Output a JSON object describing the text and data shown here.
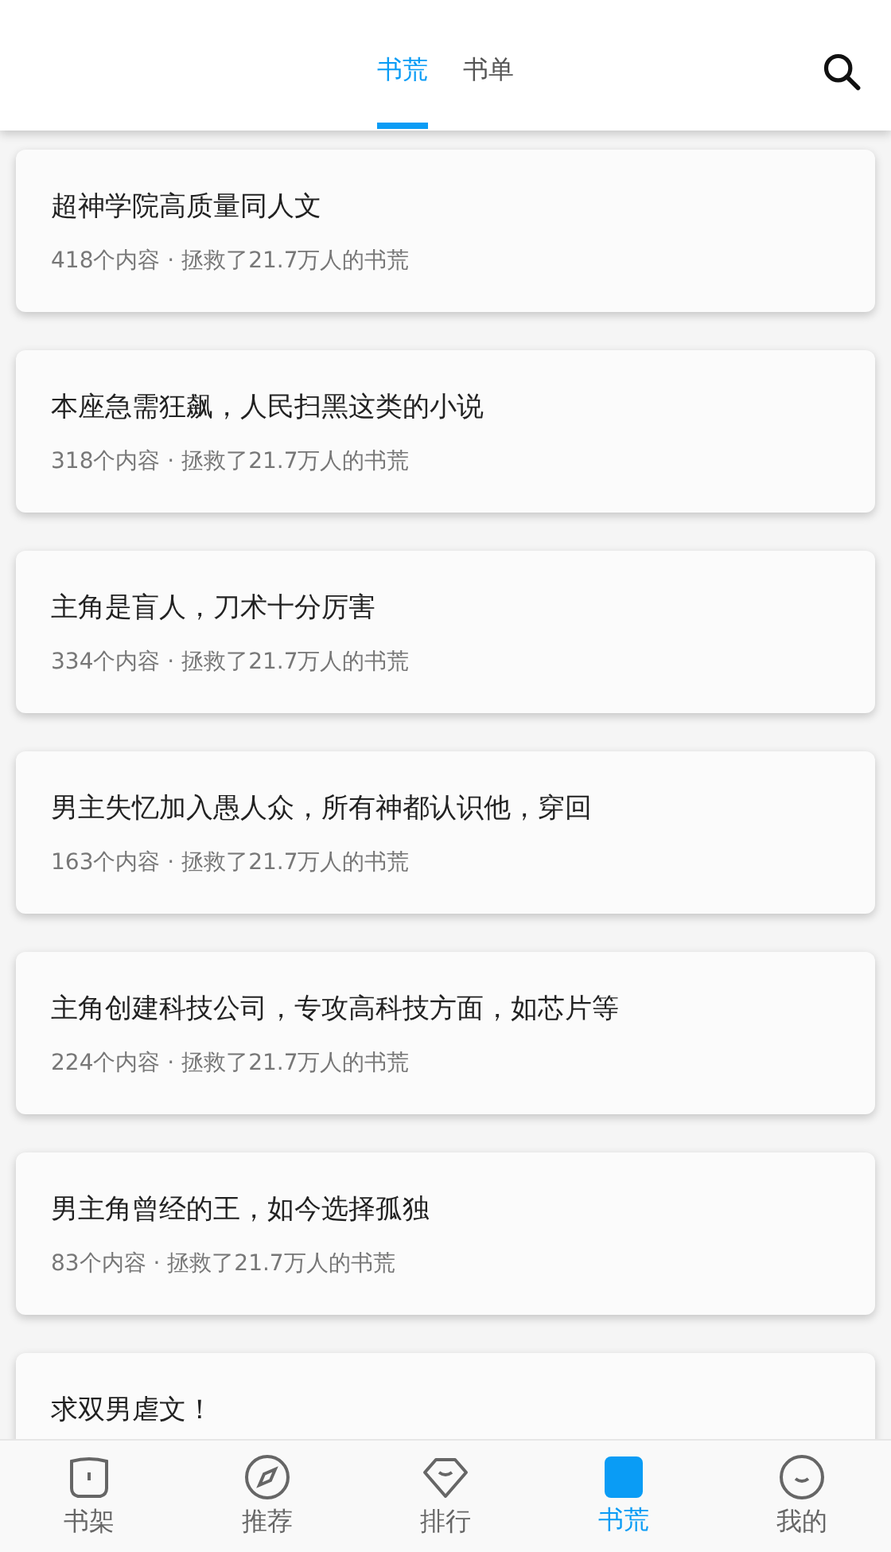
{
  "tabs": [
    {
      "label": "书荒",
      "selected": true
    },
    {
      "label": "书单",
      "selected": false
    }
  ],
  "lists": [
    {
      "title": "超神学院高质量同人文",
      "meta": "418个内容 · 拯救了21.7万人的书荒"
    },
    {
      "title": "本座急需狂飙，人民扫黑这类的小说",
      "meta": "318个内容 · 拯救了21.7万人的书荒"
    },
    {
      "title": "主角是盲人，刀术十分厉害",
      "meta": "334个内容 · 拯救了21.7万人的书荒"
    },
    {
      "title": "男主失忆加入愚人众，所有神都认识他，穿回",
      "meta": "163个内容 · 拯救了21.7万人的书荒"
    },
    {
      "title": "主角创建科技公司，专攻高科技方面，如芯片等",
      "meta": "224个内容 · 拯救了21.7万人的书荒"
    },
    {
      "title": "男主角曾经的王，如今选择孤独",
      "meta": "83个内容 · 拯救了21.7万人的书荒"
    },
    {
      "title": "求双男虐文！"
    }
  ],
  "nav": [
    {
      "label": "书架",
      "kind": "shelf",
      "selected": false
    },
    {
      "label": "推荐",
      "kind": "compass",
      "selected": false
    },
    {
      "label": "排行",
      "kind": "gem",
      "selected": false
    },
    {
      "label": "书荒",
      "kind": "square",
      "selected": true
    },
    {
      "label": "我的",
      "kind": "face",
      "selected": false
    }
  ]
}
